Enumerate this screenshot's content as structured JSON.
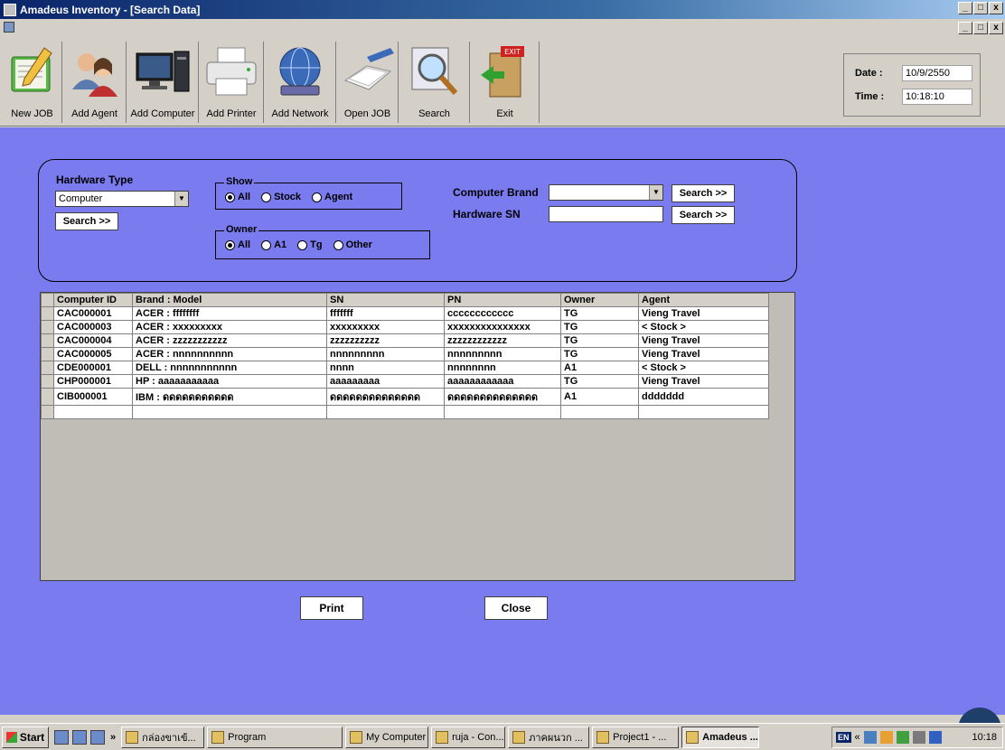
{
  "window": {
    "title": "Amadeus Inventory - [Search Data]",
    "controls": [
      "_",
      "□",
      "x"
    ]
  },
  "toolbar": {
    "items": [
      {
        "label": "New JOB",
        "icon": "notebook-pen-icon"
      },
      {
        "label": "Add Agent",
        "icon": "users-icon"
      },
      {
        "label": "Add Computer",
        "icon": "desktop-computer-icon"
      },
      {
        "label": "Add Printer",
        "icon": "printer-icon"
      },
      {
        "label": "Add Network",
        "icon": "globe-network-icon"
      },
      {
        "label": "Open JOB",
        "icon": "open-book-icon"
      },
      {
        "label": "Search",
        "icon": "magnifier-icon"
      },
      {
        "label": "Exit",
        "icon": "exit-door-icon"
      }
    ],
    "date_label": "Date :",
    "date_value": "10/9/2550",
    "time_label": "Time :",
    "time_value": "10:18:10"
  },
  "filters": {
    "hardware_type_label": "Hardware Type",
    "hardware_type_value": "Computer",
    "hardware_search": "Search >>",
    "show_label": "Show",
    "show_options": [
      "All",
      "Stock",
      "Agent"
    ],
    "show_selected": "All",
    "owner_label": "Owner",
    "owner_options": [
      "All",
      "A1",
      "Tg",
      "Other"
    ],
    "owner_selected": "All",
    "brand_label": "Computer Brand",
    "brand_value": "",
    "brand_search": "Search >>",
    "sn_label": "Hardware SN",
    "sn_value": "",
    "sn_search": "Search >>"
  },
  "grid": {
    "columns": [
      "Computer ID",
      "Brand : Model",
      "SN",
      "PN",
      "Owner",
      "Agent"
    ],
    "rows": [
      [
        "CAC000001",
        "ACER : ffffffff",
        "fffffff",
        "cccccccccccc",
        "TG",
        "Vieng Travel"
      ],
      [
        "CAC000003",
        "ACER : xxxxxxxxx",
        "xxxxxxxxx",
        "xxxxxxxxxxxxxxx",
        "TG",
        "< Stock >"
      ],
      [
        "CAC000004",
        "ACER : zzzzzzzzzzz",
        "zzzzzzzzzz",
        "zzzzzzzzzzzz",
        "TG",
        "Vieng Travel"
      ],
      [
        "CAC000005",
        "ACER : nnnnnnnnnn",
        "nnnnnnnnn",
        "nnnnnnnnn",
        "TG",
        "Vieng Travel"
      ],
      [
        "CDE000001",
        "DELL : nnnnnnnnnnn",
        "nnnn",
        "nnnnnnnn",
        "A1",
        "< Stock >"
      ],
      [
        "CHP000001",
        "HP : aaaaaaaaaaa",
        "aaaaaaaaa",
        "aaaaaaaaaaaa",
        "TG",
        "Vieng Travel"
      ],
      [
        "CIB000001",
        "IBM : ดดดดดดดดดดด",
        "ดดดดดดดดดดดดดด",
        "ดดดดดดดดดดดดดด",
        "A1",
        "ddddddd"
      ]
    ]
  },
  "actions": {
    "print": "Print",
    "close": "Close"
  },
  "taskbar": {
    "start": "Start",
    "tasks": [
      {
        "label": "กล่องขาเข้...",
        "active": false
      },
      {
        "label": "Program",
        "active": false
      },
      {
        "label": "My Computer",
        "active": false
      },
      {
        "label": "ruja - Con...",
        "active": false
      },
      {
        "label": "ภาคผนวก ...",
        "active": false
      },
      {
        "label": "Project1 - ...",
        "active": false
      },
      {
        "label": "Amadeus ...",
        "active": true
      }
    ],
    "language": "EN",
    "clock": "10:18",
    "chevron": "»",
    "tray_chevron": "«"
  }
}
